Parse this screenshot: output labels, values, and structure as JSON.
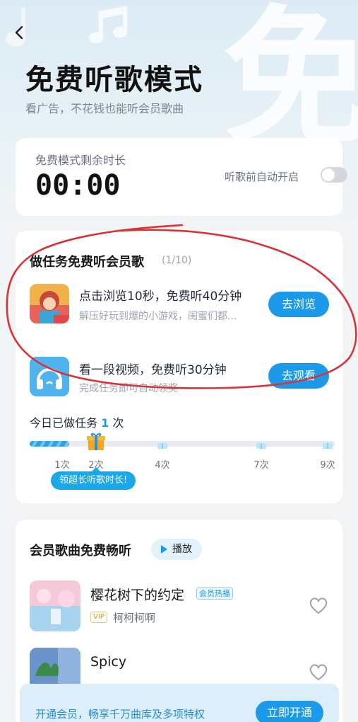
{
  "header": {
    "back_icon": "chevron-left-icon",
    "title": "免费听歌模式",
    "subtitle": "看广告，不花钱也能听会员歌曲",
    "watermark_char": "免"
  },
  "timer": {
    "label": "免费模式剩余时长",
    "value": "00:00",
    "auto_label": "听歌前自动开启",
    "auto_enabled": false
  },
  "tasks": {
    "title": "做任务免费听会员歌",
    "count": "(1/10)",
    "items": [
      {
        "icon": "game-app-icon",
        "title": "点击浏览10秒，免费听40分钟",
        "desc": "解压好玩到爆的小游戏，闺蜜们都...",
        "button": "去浏览"
      },
      {
        "icon": "headphones-icon",
        "title": "看一段视频，免费听30分钟",
        "desc": "完成任务即可自动领奖",
        "button": "去观看"
      }
    ],
    "done_prefix": "今日已做任务",
    "done_count": "1",
    "done_suffix": "次",
    "progress_fraction": 0.13,
    "steps": [
      "1次",
      "2次",
      "4次",
      "7次",
      "9次"
    ],
    "tooltip": "领超长听歌时长!"
  },
  "songs": {
    "title": "会员歌曲免费畅听",
    "play_label": "播放",
    "list": [
      {
        "title": "樱花树下的约定",
        "tag": "会员热播",
        "vip": "VIP",
        "artist": "柯柯柯啊"
      },
      {
        "title": "Spicy",
        "tag": "",
        "vip": "",
        "artist": ""
      }
    ]
  },
  "promo": {
    "text": "开通会员，畅享千万曲库及多项特权",
    "button": "立即开通"
  },
  "colors": {
    "accent": "#1a9ae8",
    "annotation": "#d9333a"
  }
}
